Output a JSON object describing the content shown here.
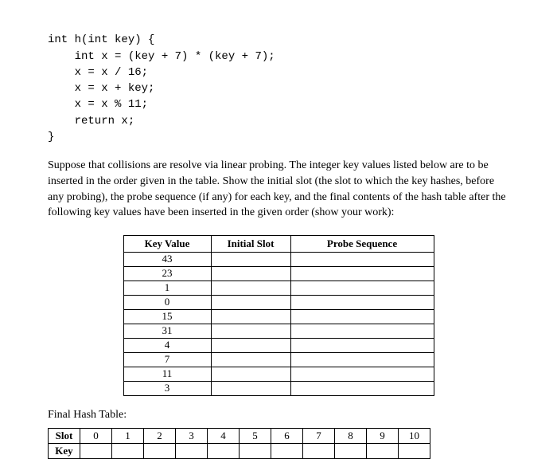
{
  "code": {
    "l1": "int h(int key) {",
    "l2": "    int x = (key + 7) * (key + 7);",
    "l3": "    x = x / 16;",
    "l4": "    x = x + key;",
    "l5": "    x = x % 11;",
    "l6": "    return x;",
    "l7": "}"
  },
  "paragraph": "Suppose that collisions are resolve via linear probing. The integer key values listed below are to be inserted in the order given in the table. Show the initial slot (the slot to which the key hashes, before any probing), the probe sequence (if any) for each key, and the final contents of the hash table after the following key values have been inserted in the given order (show your work):",
  "table1": {
    "headers": {
      "kv": "Key Value",
      "is": "Initial Slot",
      "ps": "Probe Sequence"
    },
    "rows": [
      {
        "kv": "43",
        "is": "",
        "ps": ""
      },
      {
        "kv": "23",
        "is": "",
        "ps": ""
      },
      {
        "kv": "1",
        "is": "",
        "ps": ""
      },
      {
        "kv": "0",
        "is": "",
        "ps": ""
      },
      {
        "kv": "15",
        "is": "",
        "ps": ""
      },
      {
        "kv": "31",
        "is": "",
        "ps": ""
      },
      {
        "kv": "4",
        "is": "",
        "ps": ""
      },
      {
        "kv": "7",
        "is": "",
        "ps": ""
      },
      {
        "kv": "11",
        "is": "",
        "ps": ""
      },
      {
        "kv": "3",
        "is": "",
        "ps": ""
      }
    ]
  },
  "final_label": "Final Hash Table:",
  "table2": {
    "slot_label": "Slot",
    "key_label": "Key",
    "slots": [
      "0",
      "1",
      "2",
      "3",
      "4",
      "5",
      "6",
      "7",
      "8",
      "9",
      "10"
    ],
    "keys": [
      "",
      "",
      "",
      "",
      "",
      "",
      "",
      "",
      "",
      "",
      ""
    ]
  }
}
